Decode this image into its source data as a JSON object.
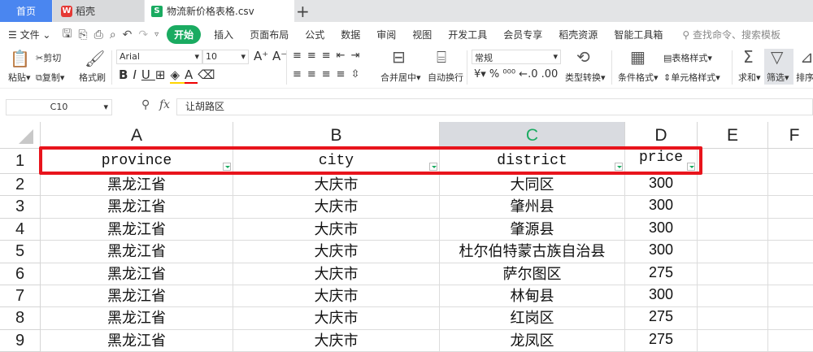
{
  "tabs": {
    "home": "首页",
    "wps": "稻壳",
    "file": "物流新价格表格.csv",
    "file_icon": "S",
    "wps_icon": "W"
  },
  "menu": {
    "file": "文件",
    "items": [
      "开始",
      "插入",
      "页面布局",
      "公式",
      "数据",
      "审阅",
      "视图",
      "开发工具",
      "会员专享",
      "稻壳资源",
      "智能工具箱"
    ],
    "search": "查找命令、搜索模板"
  },
  "ribbon": {
    "paste": "粘贴",
    "cut": "剪切",
    "copy": "复制",
    "format_painter": "格式刷",
    "font": "Arial",
    "size": "10",
    "merge": "合并居中",
    "wrap": "自动换行",
    "number_format": "常规",
    "convert": "类型转换",
    "cond_format": "条件格式",
    "table_style": "表格样式",
    "cell_style": "单元格样式",
    "sum": "求和",
    "filter": "筛选",
    "sort": "排序"
  },
  "formula_bar": {
    "cell_ref": "C10",
    "fx": "fx",
    "value": "让胡路区"
  },
  "sheet": {
    "columns": [
      "A",
      "B",
      "C",
      "D",
      "E",
      "F"
    ],
    "active_column": "C",
    "header_row": [
      "province",
      "city",
      "district",
      "price"
    ],
    "rows": [
      [
        "黑龙江省",
        "大庆市",
        "大同区",
        "300"
      ],
      [
        "黑龙江省",
        "大庆市",
        "肇州县",
        "300"
      ],
      [
        "黑龙江省",
        "大庆市",
        "肇源县",
        "300"
      ],
      [
        "黑龙江省",
        "大庆市",
        "杜尔伯特蒙古族自治县",
        "300"
      ],
      [
        "黑龙江省",
        "大庆市",
        "萨尔图区",
        "275"
      ],
      [
        "黑龙江省",
        "大庆市",
        "林甸县",
        "300"
      ],
      [
        "黑龙江省",
        "大庆市",
        "红岗区",
        "275"
      ],
      [
        "黑龙江省",
        "大庆市",
        "龙凤区",
        "275"
      ]
    ],
    "row_numbers": [
      "1",
      "2",
      "3",
      "4",
      "5",
      "6",
      "7",
      "8",
      "9"
    ]
  },
  "colors": {
    "accent": "#1aab61",
    "highlight": "#e8141c",
    "home_tab": "#4a86f0"
  }
}
